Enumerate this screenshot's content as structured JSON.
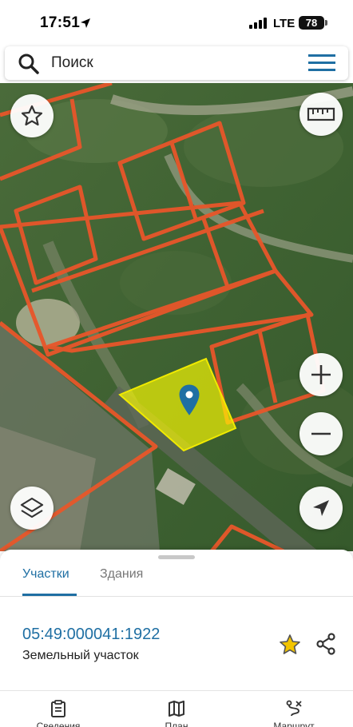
{
  "status_bar": {
    "time": "17:51",
    "network": "LTE",
    "battery": "78"
  },
  "search": {
    "placeholder": "Поиск"
  },
  "map": {
    "parcel_fill_color": "#ffff00",
    "boundary_color": "#e8562a",
    "controls": [
      "star-icon",
      "ruler-icon",
      "zoom-in-icon",
      "zoom-out-icon",
      "layers-icon",
      "navigate-icon"
    ]
  },
  "sheet": {
    "tabs": [
      {
        "label": "Участки",
        "active": true
      },
      {
        "label": "Здания",
        "active": false
      }
    ],
    "parcel": {
      "number": "05:49:000041:1922",
      "type": "Земельный участок"
    }
  },
  "bottom_nav": {
    "items": [
      {
        "label": "Сведения",
        "icon": "clipboard-icon"
      },
      {
        "label": "План",
        "icon": "map-icon"
      },
      {
        "label": "Маршрут",
        "icon": "route-icon"
      }
    ]
  },
  "colors": {
    "accent": "#1f6fa3",
    "star": "#f2c400"
  }
}
